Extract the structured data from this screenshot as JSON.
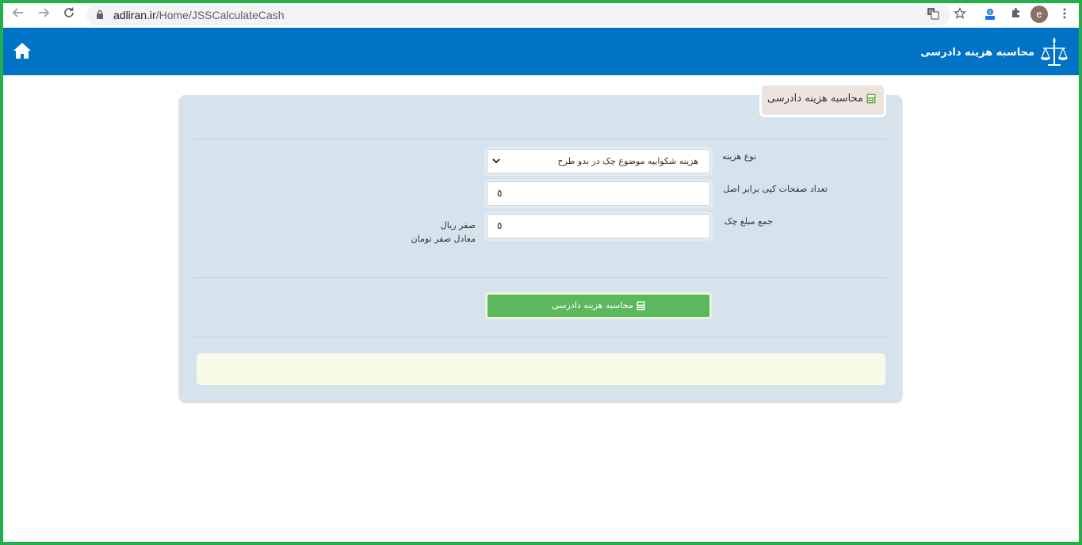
{
  "browser": {
    "url_domain": "adliran.ir",
    "url_path": "/Home/JSSCalculateCash",
    "profile_initial": "e",
    "icons": [
      "back-icon",
      "forward-icon",
      "reload-icon",
      "lock-icon",
      "translate-icon",
      "star-icon",
      "extension-badge-icon",
      "puzzle-icon",
      "kebab-menu-icon"
    ]
  },
  "header": {
    "title": "محاسبه هزینه دادرسی",
    "bg_color": "#0173c7",
    "icons": [
      "home-icon",
      "justice-scales-logo-icon"
    ]
  },
  "panel": {
    "tab_title": "محاسبه هزینه دادرسی",
    "fields": {
      "cost_type": {
        "label": "نوع هزینه",
        "selected": "هزینه شکواییه موضوع چک در بدو طرح"
      },
      "page_count": {
        "label": "تعداد صفحات کپی برابر اصل",
        "value": "٥"
      },
      "check_amount": {
        "label": "جمع مبلغ چک",
        "value": "٥"
      }
    },
    "amount_rial": "صفر ریال",
    "amount_toman": "معادل صفر تومان",
    "button_label": "محاسبه هزینه دادرسی",
    "button_color": "#5cb85c",
    "result_text": ""
  }
}
